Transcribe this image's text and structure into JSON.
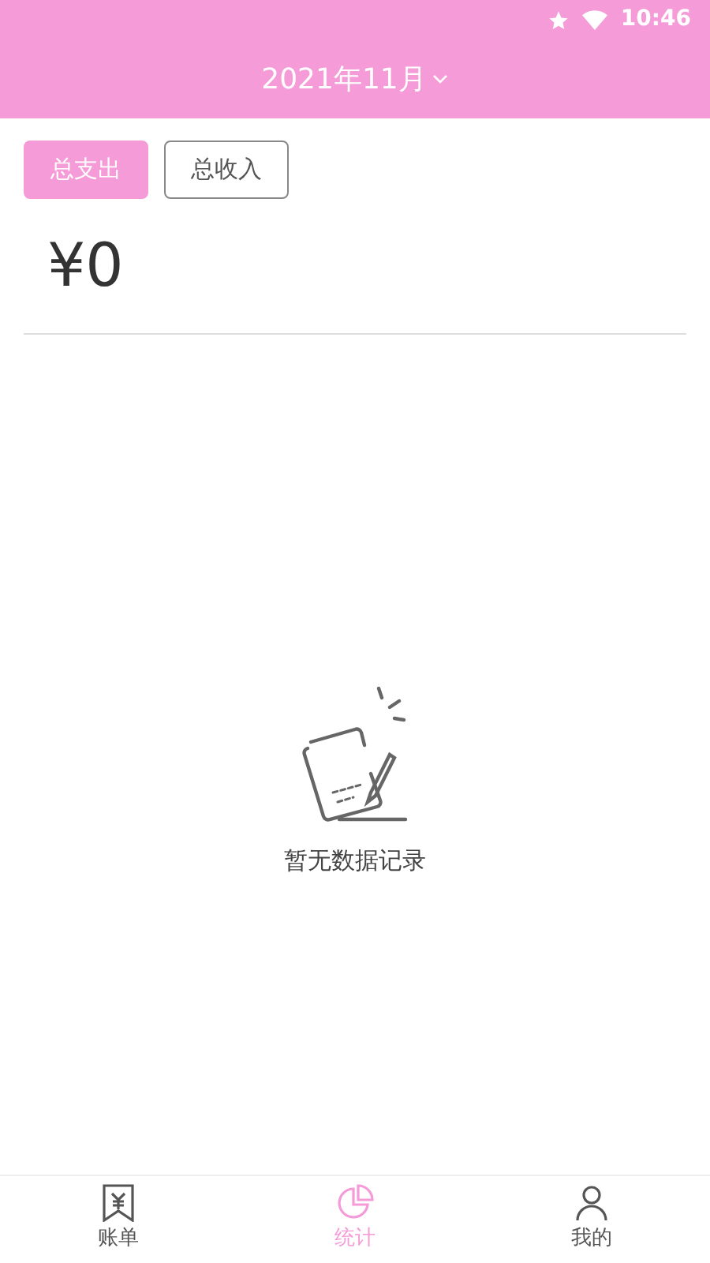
{
  "status_bar": {
    "time": "10:46"
  },
  "header": {
    "title": "2021年11月"
  },
  "type_buttons": [
    {
      "label": "总支出",
      "selected": true
    },
    {
      "label": "总收入",
      "selected": false
    }
  ],
  "total": "¥0",
  "empty_state": {
    "message": "暂无数据记录"
  },
  "tab_bar": [
    {
      "label": "账单",
      "kind": "bill",
      "selected": false
    },
    {
      "label": "统计",
      "kind": "stats",
      "selected": true
    },
    {
      "label": "我的",
      "kind": "me",
      "selected": false
    }
  ]
}
